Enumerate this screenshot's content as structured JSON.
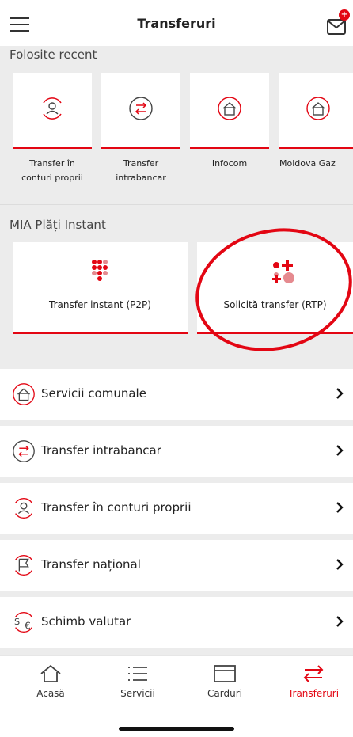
{
  "header": {
    "title": "Transferuri",
    "mail_badge": "+"
  },
  "recent": {
    "section_label": "Folosite recent",
    "cards": [
      {
        "label": "Transfer în\nconturi proprii",
        "icon": "own-accounts-icon"
      },
      {
        "label": "Transfer\nintrabancar",
        "icon": "intrabank-icon"
      },
      {
        "label": "Infocom",
        "icon": "utilities-house-icon"
      },
      {
        "label": "Moldova Gaz",
        "icon": "utilities-house-icon"
      }
    ]
  },
  "mia": {
    "section_label": "MIA Plăți Instant",
    "cards": [
      {
        "label": "Transfer instant (P2P)",
        "icon": "p2p-dots-icon"
      },
      {
        "label": "Solicită transfer (RTP)",
        "icon": "rtp-dots-icon"
      }
    ]
  },
  "list": [
    {
      "label": "Servicii comunale",
      "icon": "utilities-house-icon"
    },
    {
      "label": "Transfer intrabancar",
      "icon": "intrabank-icon"
    },
    {
      "label": "Transfer în conturi proprii",
      "icon": "own-accounts-icon"
    },
    {
      "label": "Transfer național",
      "icon": "national-transfer-icon"
    },
    {
      "label": "Schimb valutar",
      "icon": "currency-exchange-icon"
    }
  ],
  "nav": [
    {
      "label": "Acasă",
      "icon": "home-icon"
    },
    {
      "label": "Servicii",
      "icon": "list-icon"
    },
    {
      "label": "Carduri",
      "icon": "card-icon"
    },
    {
      "label": "Transferuri",
      "icon": "transfer-arrows-icon",
      "active": true
    }
  ],
  "colors": {
    "accent": "#e30613",
    "background_gray": "#ececec"
  }
}
